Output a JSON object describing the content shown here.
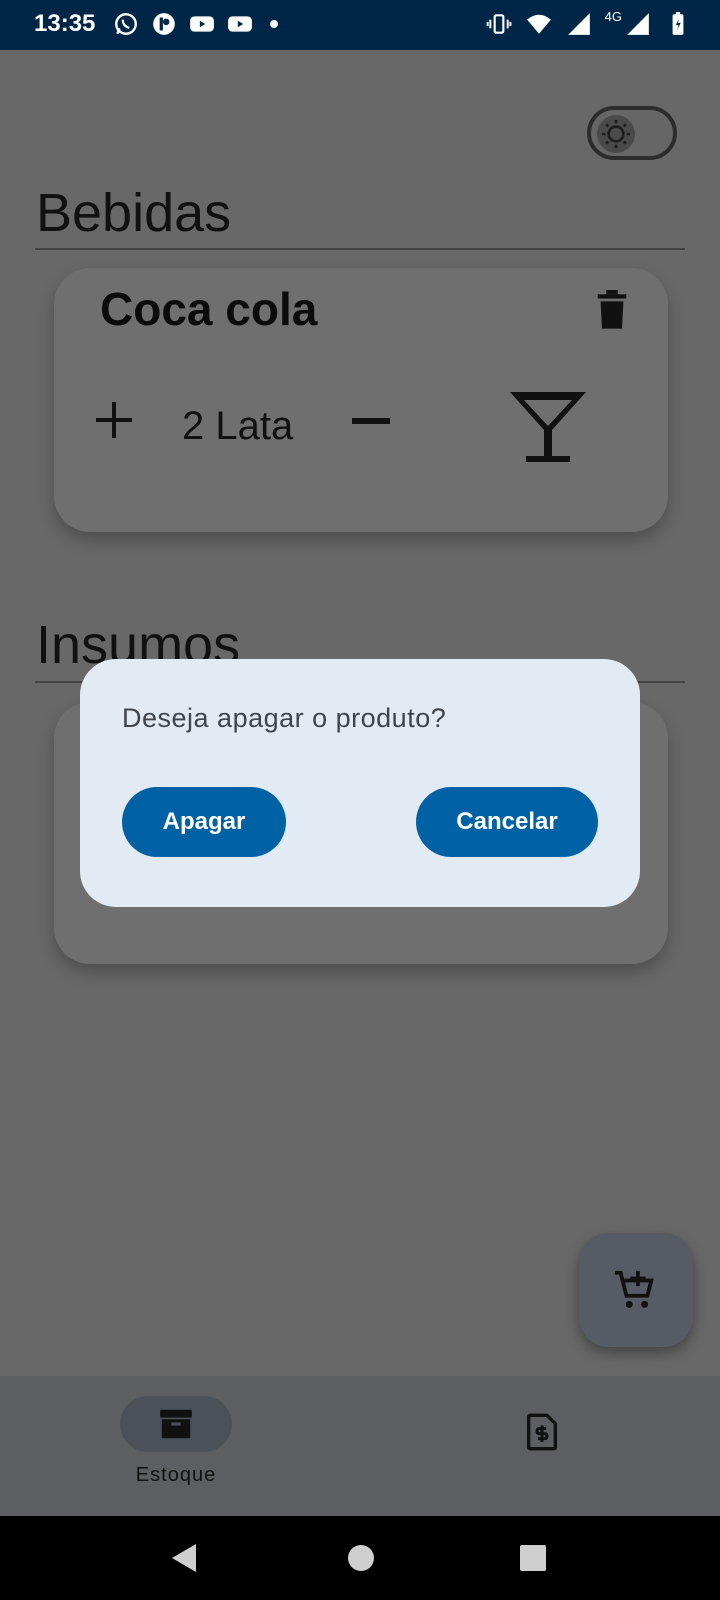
{
  "status_bar": {
    "time": "13:35",
    "network_label": "4G",
    "left_icons": [
      "whatsapp-icon",
      "app-icon",
      "youtube-icon",
      "youtube-icon",
      "notification-dot"
    ],
    "right_icons": [
      "vibrate-icon",
      "wifi-icon",
      "signal-icon",
      "signal-icon",
      "battery-icon"
    ]
  },
  "theme_toggle": {
    "icon": "sun-icon"
  },
  "sections": [
    {
      "title": "Bebidas",
      "products": [
        {
          "name": "Coca cola",
          "quantity": "2 Lata",
          "category_icon": "cocktail-glass-icon"
        }
      ]
    },
    {
      "title": "Insumos",
      "products": []
    }
  ],
  "fab": {
    "icon": "add-to-cart-icon"
  },
  "bottom_nav": {
    "items": [
      {
        "label": "Estoque",
        "icon": "archive-box-icon",
        "active": true
      },
      {
        "label": "",
        "icon": "invoice-dollar-icon",
        "active": false
      }
    ]
  },
  "dialog": {
    "message": "Deseja apagar o produto?",
    "confirm_label": "Apagar",
    "cancel_label": "Cancelar"
  },
  "colors": {
    "status_bar_bg": "#002647",
    "dialog_bg": "#e2ebf4",
    "button_primary": "#0061a4",
    "scrim": "#686868"
  }
}
